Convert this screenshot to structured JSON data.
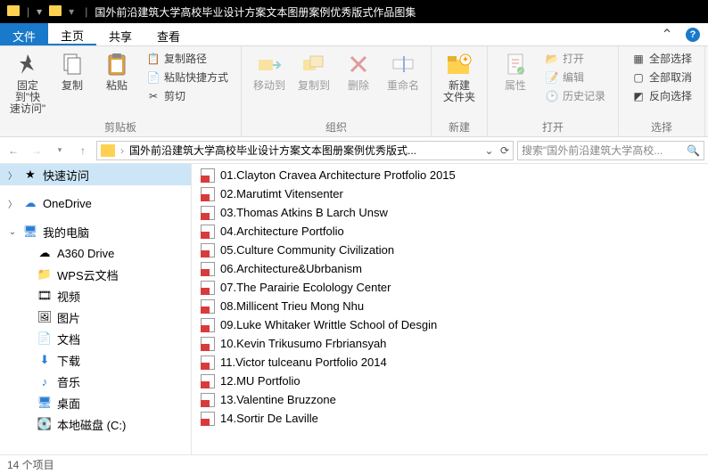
{
  "title": "国外前沿建筑大学高校毕业设计方案文本图册案例优秀版式作品图集",
  "menu": {
    "file": "文件",
    "home": "主页",
    "share": "共享",
    "view": "查看"
  },
  "ribbon": {
    "pin": "固定到\"快\n速访问\"",
    "copy": "复制",
    "paste": "粘贴",
    "copy_path": "复制路径",
    "paste_shortcut": "粘贴快捷方式",
    "cut": "剪切",
    "clipboard": "剪贴板",
    "move_to": "移动到",
    "copy_to": "复制到",
    "delete": "删除",
    "rename": "重命名",
    "organize": "组织",
    "new_folder": "新建\n文件夹",
    "new": "新建",
    "properties": "属性",
    "open": "打开",
    "edit": "编辑",
    "history": "历史记录",
    "open_group": "打开",
    "select_all": "全部选择",
    "select_none": "全部取消",
    "invert": "反向选择",
    "select": "选择"
  },
  "address": {
    "path": "国外前沿建筑大学高校毕业设计方案文本图册案例优秀版式...",
    "search_placeholder": "搜索\"国外前沿建筑大学高校..."
  },
  "nav": {
    "quick": "快速访问",
    "onedrive": "OneDrive",
    "thispc": "我的电脑",
    "a360": "A360 Drive",
    "wps": "WPS云文档",
    "videos": "视频",
    "pictures": "图片",
    "documents": "文档",
    "downloads": "下载",
    "music": "音乐",
    "desktop": "桌面",
    "localdisk": "本地磁盘 (C:)"
  },
  "files": [
    "01.Clayton Cravea Architecture Protfolio 2015",
    "02.Marutimt Vitensenter",
    "03.Thomas Atkins B Larch Unsw",
    "04.Architecture Portfolio",
    "05.Culture Community Civilization",
    "06.Architecture&Ubrbanism",
    "07.The Parairie Ecolology Center",
    "08.Millicent Trieu Mong Nhu",
    "09.Luke Whitaker Writtle School of Desgin",
    "10.Kevin Trikusumo Frbriansyah",
    "11.Victor tulceanu Portfolio 2014",
    "12.MU Portfolio",
    "13.Valentine Bruzzone",
    "14.Sortir De Laville"
  ],
  "status": "14 个项目"
}
